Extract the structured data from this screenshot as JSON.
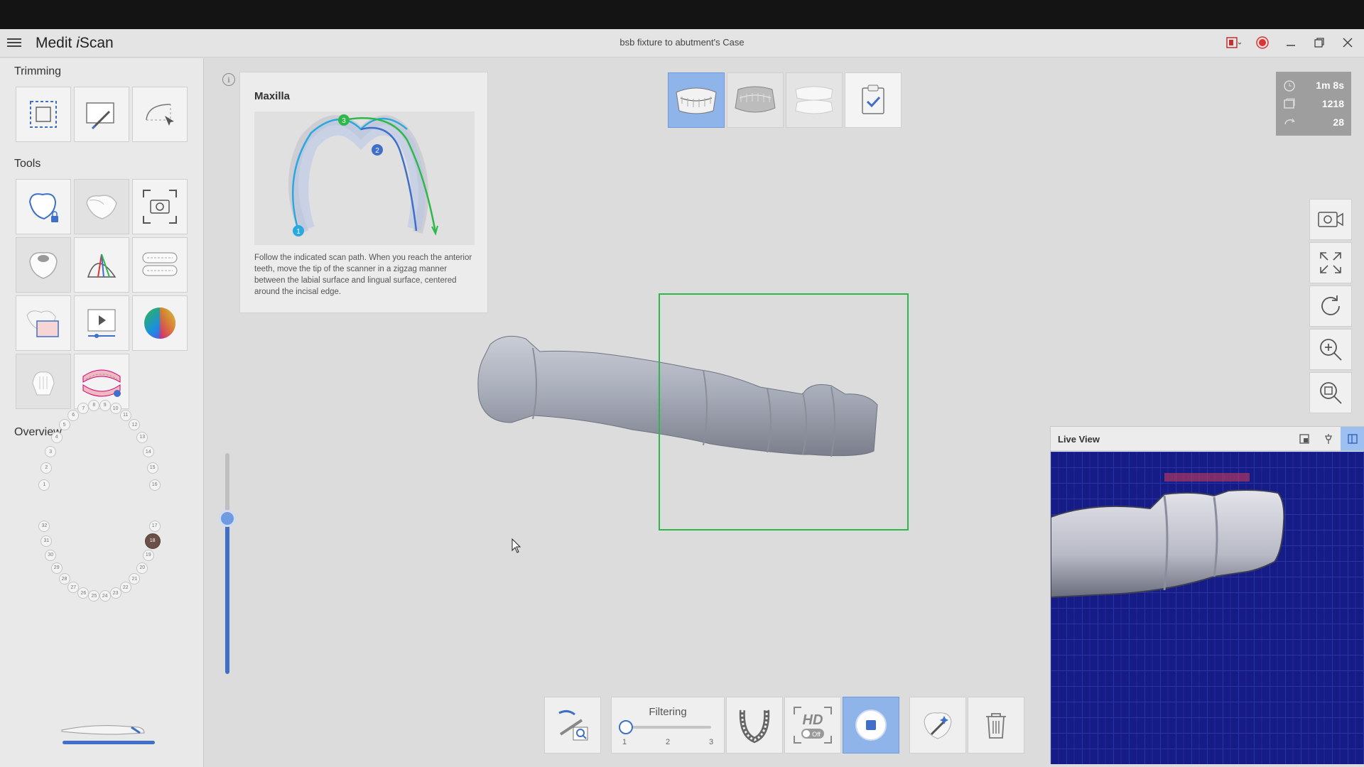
{
  "app": {
    "title_prefix": "Medit ",
    "title_italic": "i",
    "title_suffix": "Scan",
    "case_title": "bsb fixture to abutment's Case"
  },
  "sidebar": {
    "trimming_title": "Trimming",
    "tools_title": "Tools",
    "overview_title": "Overview",
    "trimming_tools": [
      "trim-selection-icon",
      "trim-brush-icon",
      "trim-lasso-icon"
    ],
    "tools": [
      "lock-tooth-icon",
      "tooth-shade-icon",
      "capture-icon",
      "crown-tooth-icon",
      "ai-cone-icon",
      "arch-icon",
      "margin-icon",
      "playback-icon",
      "color-wheel-icon",
      "implant-icon",
      "jaw-model-icon"
    ],
    "overview_teeth_upper": [
      "1",
      "2",
      "3",
      "4",
      "5",
      "6",
      "7",
      "8",
      "9",
      "10",
      "11",
      "12",
      "13",
      "14",
      "15",
      "16"
    ],
    "overview_teeth_lower": [
      "17",
      "18",
      "19",
      "20",
      "21",
      "22",
      "23",
      "24",
      "25",
      "26",
      "27",
      "28",
      "29",
      "30",
      "31",
      "32"
    ],
    "active_tooth": "18"
  },
  "guide": {
    "title": "Maxilla",
    "step_labels": [
      "1",
      "2",
      "3"
    ],
    "text": "Follow the indicated scan path. When you reach the anterior teeth, move the tip of the scanner in a zigzag manner between the labial surface and lingual surface, centered around the incisal edge."
  },
  "stages": [
    "maxilla-stage-icon",
    "mandible-stage-icon",
    "occlusion-stage-icon",
    "complete-check-icon"
  ],
  "stats": {
    "time": "1m 8s",
    "images": "1218",
    "rotations": "28"
  },
  "right_toolbar": [
    "video-record-icon",
    "fit-screen-icon",
    "rotate-icon",
    "zoom-in-icon",
    "zoom-fit-icon"
  ],
  "live_view": {
    "title": "Live View"
  },
  "bottom": {
    "filtering_label": "Filtering",
    "filter_ticks": [
      "1",
      "2",
      "3"
    ],
    "filter_value": 1,
    "hd_label": "HD",
    "hd_state": "Off"
  },
  "colors": {
    "accent": "#3f6fc8",
    "active_stage": "#8fb4ea",
    "scan_box": "#2fb84a",
    "active_tooth": "#6b5047"
  }
}
